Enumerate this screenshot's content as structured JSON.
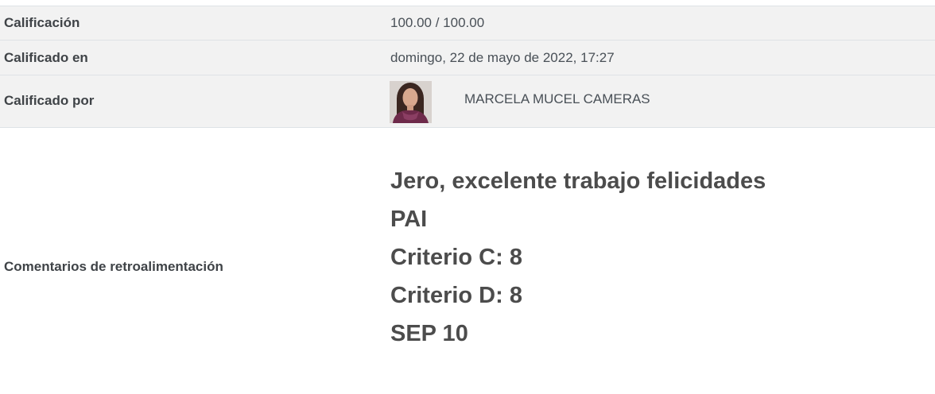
{
  "rows": {
    "grade": {
      "label": "Calificación",
      "value": "100.00 / 100.00"
    },
    "graded_on": {
      "label": "Calificado en",
      "value": "domingo, 22 de mayo de 2022, 17:27"
    },
    "graded_by": {
      "label": "Calificado por",
      "name": "MARCELA MUCEL CAMERAS"
    }
  },
  "feedback": {
    "label": "Comentarios de retroalimentación",
    "lines": [
      "Jero, excelente trabajo felicidades",
      "PAI",
      "Criterio C: 8",
      "Criterio D: 8",
      "SEP 10"
    ]
  },
  "colors": {
    "row_shaded_bg": "#f2f2f2",
    "border": "#dee2e6",
    "label_text": "#3f4347",
    "value_text": "#495057"
  }
}
